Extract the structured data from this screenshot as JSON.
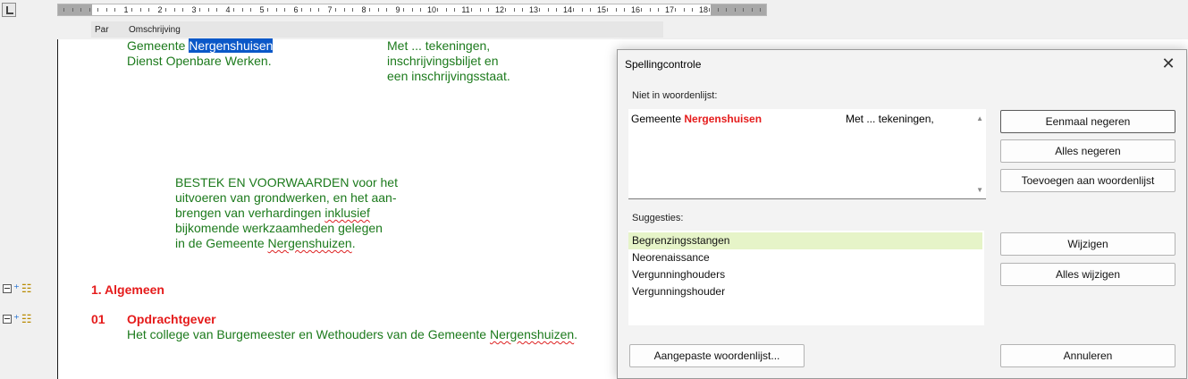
{
  "ruler": {
    "labels": [
      "1",
      "2",
      "3",
      "4",
      "5",
      "6",
      "7",
      "8",
      "9",
      "10",
      "11",
      "12",
      "13",
      "14",
      "15",
      "16",
      "17",
      "18"
    ]
  },
  "columns": {
    "par": "Par",
    "omschrijving": "Omschrijving"
  },
  "document": {
    "line1_prefix": "Gemeente ",
    "line1_selected": "Nergenshuisen",
    "line2": "Dienst Openbare Werken.",
    "right1": "Met ... tekeningen,",
    "right2": "inschrijvingsbiljet en",
    "right3": "een inschrijvingsstaat.",
    "bestek": {
      "l1": "BESTEK EN VOORWAARDEN voor het",
      "l2": "uitvoeren van grondwerken, en het aan-",
      "l3a": "brengen van verhardingen ",
      "l3b": "inklusief",
      "l4": "bijkomende werkzaamheden gelegen",
      "l5a": "in de Gemeente ",
      "l5b": "Nergenshuizen",
      "l5c": "."
    },
    "section1": {
      "num": "1. Algemeen"
    },
    "section01": {
      "num": "01",
      "title": "Opdrachtgever",
      "text_a": "Het college van Burgemeester en Wethouders van de Gemeente ",
      "text_b": "Nergenshuizen",
      "text_c": "."
    }
  },
  "dialog": {
    "title": "Spellingcontrole",
    "close": "✕",
    "not_in_list_label": "Niet in woordenlijst:",
    "not_in_list": {
      "prefix": "Gemeente ",
      "word": "Nergenshuisen",
      "right": "Met ... tekeningen,"
    },
    "suggestions_label": "Suggesties:",
    "suggestions": [
      "Begrenzingsstangen",
      "Neorenaissance",
      "Vergunninghouders",
      "Vergunningshouder"
    ],
    "buttons": {
      "ignore_once": "Eenmaal negeren",
      "ignore_all": "Alles negeren",
      "add_to_dict": "Toevoegen aan woordenlijst",
      "change": "Wijzigen",
      "change_all": "Alles wijzigen",
      "custom_dict": "Aangepaste woordenlijst...",
      "cancel": "Annuleren"
    }
  }
}
